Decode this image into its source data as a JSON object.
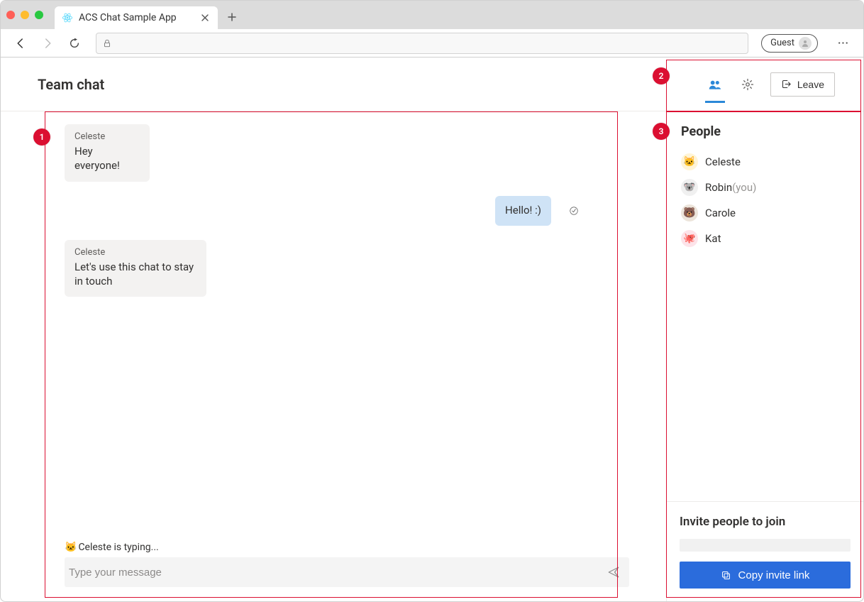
{
  "browser": {
    "tab_title": "ACS Chat Sample App",
    "guest_label": "Guest"
  },
  "header": {
    "title": "Team chat",
    "leave_label": "Leave"
  },
  "chat": {
    "messages": [
      {
        "sender": "Celeste",
        "text": "Hey everyone!",
        "side": "left",
        "avatar": "🐱"
      },
      {
        "sender": "",
        "text": "Hello! :)",
        "side": "right",
        "avatar": ""
      },
      {
        "sender": "Celeste",
        "text": "Let's use this chat to stay in touch",
        "side": "left",
        "avatar": "🐱"
      }
    ],
    "typing_indicator": {
      "avatar": "🐱",
      "text": "Celeste is typing..."
    },
    "composer_placeholder": "Type your message"
  },
  "sidebar": {
    "people_heading": "People",
    "people": [
      {
        "name": "Celeste",
        "avatar": "🐱",
        "bg": "#fff4d6",
        "you": false
      },
      {
        "name": "Robin",
        "avatar": "🐨",
        "bg": "#f0f0f0",
        "you": true
      },
      {
        "name": "Carole",
        "avatar": "🐻",
        "bg": "#ece4da",
        "you": false
      },
      {
        "name": "Kat",
        "avatar": "🐙",
        "bg": "#fde3e9",
        "you": false
      }
    ],
    "you_suffix": "(you)",
    "invite_heading": "Invite people to join",
    "copy_label": "Copy invite link"
  },
  "annotations": {
    "callout1": "1",
    "callout2": "2",
    "callout3": "3"
  }
}
